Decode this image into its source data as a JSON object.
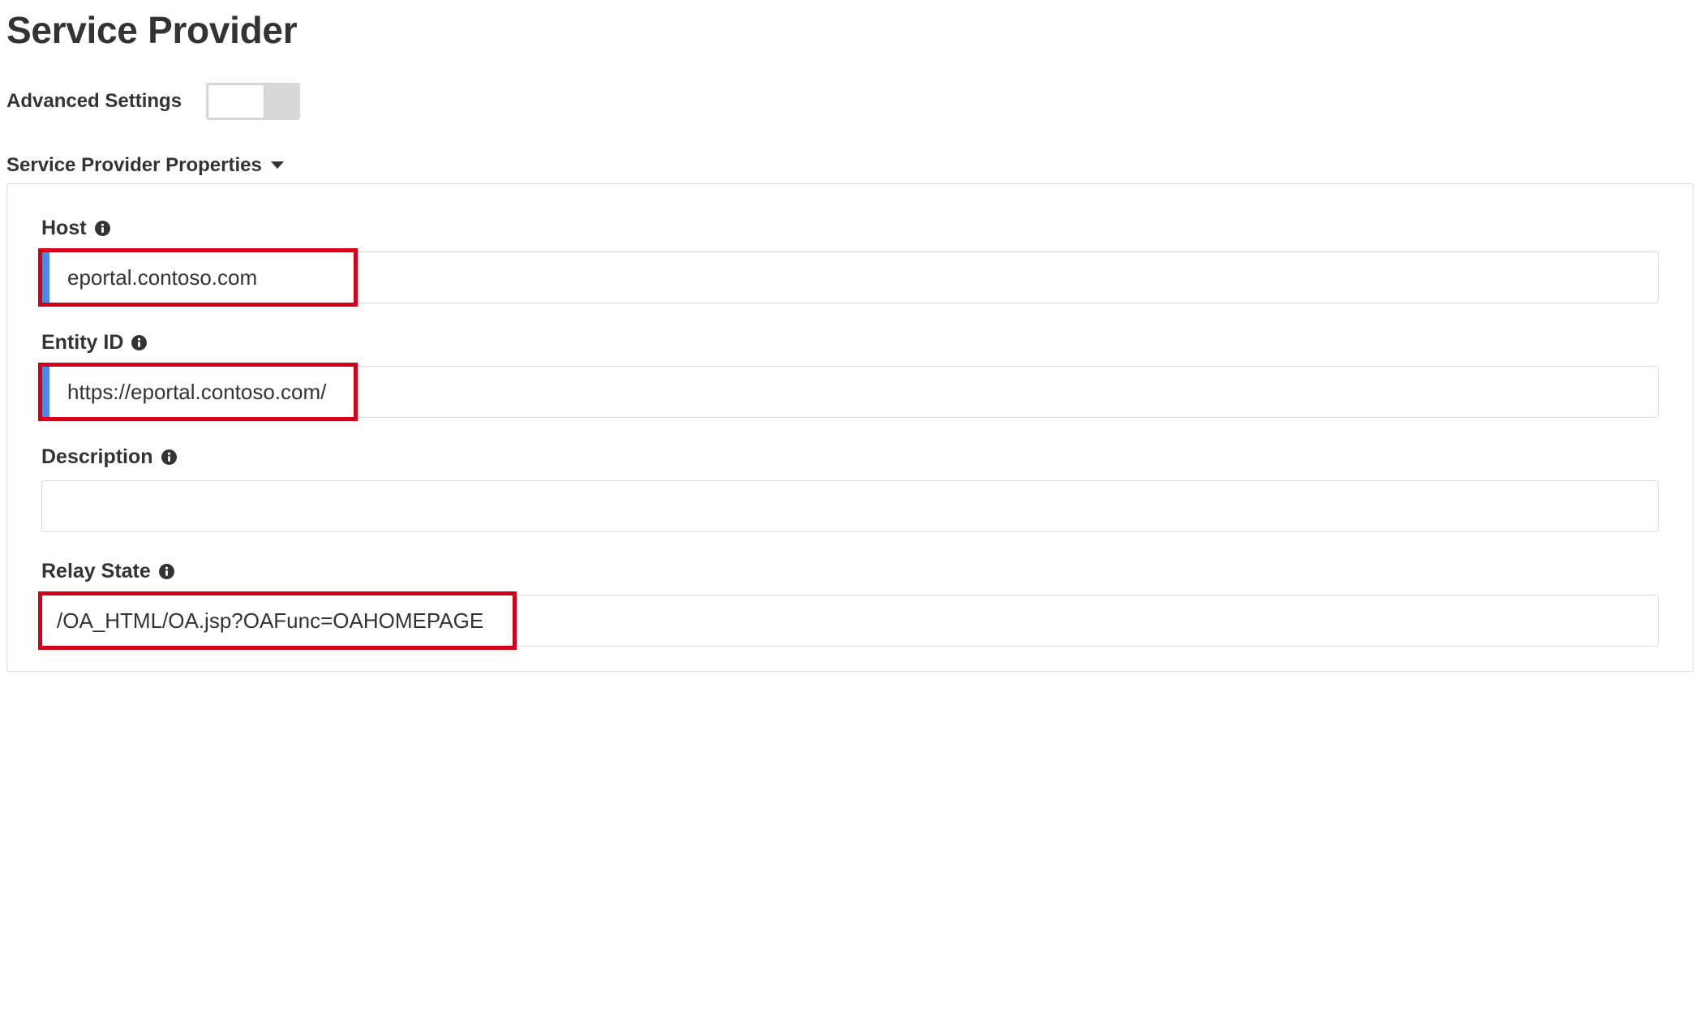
{
  "header": {
    "title": "Service Provider"
  },
  "advanced": {
    "label": "Advanced Settings",
    "enabled": false
  },
  "section": {
    "title": "Service Provider Properties"
  },
  "fields": {
    "host": {
      "label": "Host",
      "value": "eportal.contoso.com"
    },
    "entity_id": {
      "label": "Entity ID",
      "value": "https://eportal.contoso.com/"
    },
    "description": {
      "label": "Description",
      "value": ""
    },
    "relay_state": {
      "label": "Relay State",
      "value": "/OA_HTML/OA.jsp?OAFunc=OAHOMEPAGE"
    }
  }
}
